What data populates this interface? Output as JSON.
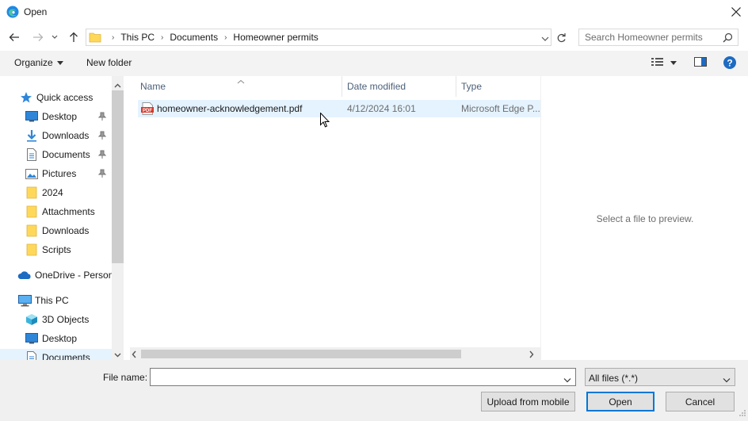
{
  "window": {
    "title": "Open",
    "close_icon": "close-icon",
    "app_icon": "edge-icon"
  },
  "navigation": {
    "breadcrumbs": [
      "This PC",
      "Documents",
      "Homeowner permits"
    ],
    "search_placeholder": "Search Homeowner permits"
  },
  "toolbar": {
    "organize_label": "Organize",
    "new_folder_label": "New folder"
  },
  "sidebar": {
    "items": [
      {
        "label": "Quick access",
        "icon": "star-icon",
        "pinned": false
      },
      {
        "label": "Desktop",
        "icon": "desktop-icon",
        "pinned": true
      },
      {
        "label": "Downloads",
        "icon": "download-icon",
        "pinned": true
      },
      {
        "label": "Documents",
        "icon": "document-icon",
        "pinned": true
      },
      {
        "label": "Pictures",
        "icon": "pictures-icon",
        "pinned": true
      },
      {
        "label": "2024",
        "icon": "folder-icon",
        "pinned": false
      },
      {
        "label": "Attachments",
        "icon": "folder-icon",
        "pinned": false
      },
      {
        "label": "Downloads",
        "icon": "folder-icon",
        "pinned": false
      },
      {
        "label": "Scripts",
        "icon": "folder-icon",
        "pinned": false
      },
      {
        "label": "OneDrive - Personal",
        "icon": "onedrive-icon",
        "pinned": false
      },
      {
        "label": "This PC",
        "icon": "computer-icon",
        "pinned": false
      },
      {
        "label": "3D Objects",
        "icon": "cube-icon",
        "pinned": false
      },
      {
        "label": "Desktop",
        "icon": "desktop-icon",
        "pinned": false
      },
      {
        "label": "Documents",
        "icon": "document-icon",
        "pinned": false
      }
    ]
  },
  "filelist": {
    "columns": [
      "Name",
      "Date modified",
      "Type"
    ],
    "rows": [
      {
        "name": "homeowner-acknowledgement.pdf",
        "date": "4/12/2024 16:01",
        "type": "Microsoft Edge P...",
        "icon": "pdf-icon"
      }
    ]
  },
  "preview": {
    "message": "Select a file to preview."
  },
  "footer": {
    "filename_label": "File name:",
    "filename_value": "",
    "filter_value": "All files (*.*)",
    "upload_label": "Upload from mobile",
    "open_label": "Open",
    "cancel_label": "Cancel"
  },
  "colors": {
    "accent": "#0078d7",
    "selection": "#e5f3ff",
    "folder": "#ffd85a",
    "pdf": "#d6372b"
  }
}
